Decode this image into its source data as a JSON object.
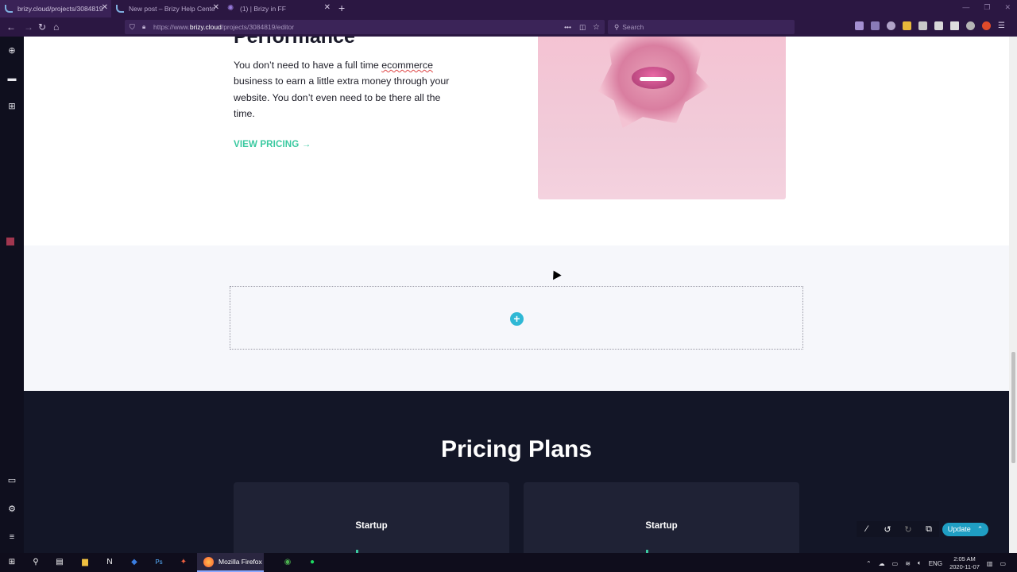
{
  "browser": {
    "tabs": [
      {
        "title": "brizy.cloud/projects/3084819/"
      },
      {
        "title": "New post – Brizy Help Center"
      },
      {
        "title": "(1) | Brizy in FF"
      }
    ],
    "url_prefix": "https://www.",
    "url_host": "brizy.cloud",
    "url_path": "/projects/3084819/editor",
    "search_placeholder": "Search"
  },
  "content": {
    "heading_partial": "Performance",
    "paragraph_before": "You don’t need to have a full time ",
    "paragraph_link": "ecommerce",
    "paragraph_after": " business to earn a little extra money through your website. You don’t even need to be there all the time.",
    "cta": "VIEW PRICING",
    "cta_arrow": "→",
    "pricing_title": "Pricing Plans",
    "cards": [
      {
        "title": "Startup"
      },
      {
        "title": "Startup"
      }
    ]
  },
  "editor": {
    "update_label": "Update",
    "add_symbol": "+",
    "brand_color": "#1f9ec3",
    "accent_color": "#3ac9a0"
  },
  "taskbar": {
    "firefox_label": "Mozilla Firefox",
    "lang": "ENG",
    "time": "2:05 AM",
    "date": "2020-11-07"
  }
}
